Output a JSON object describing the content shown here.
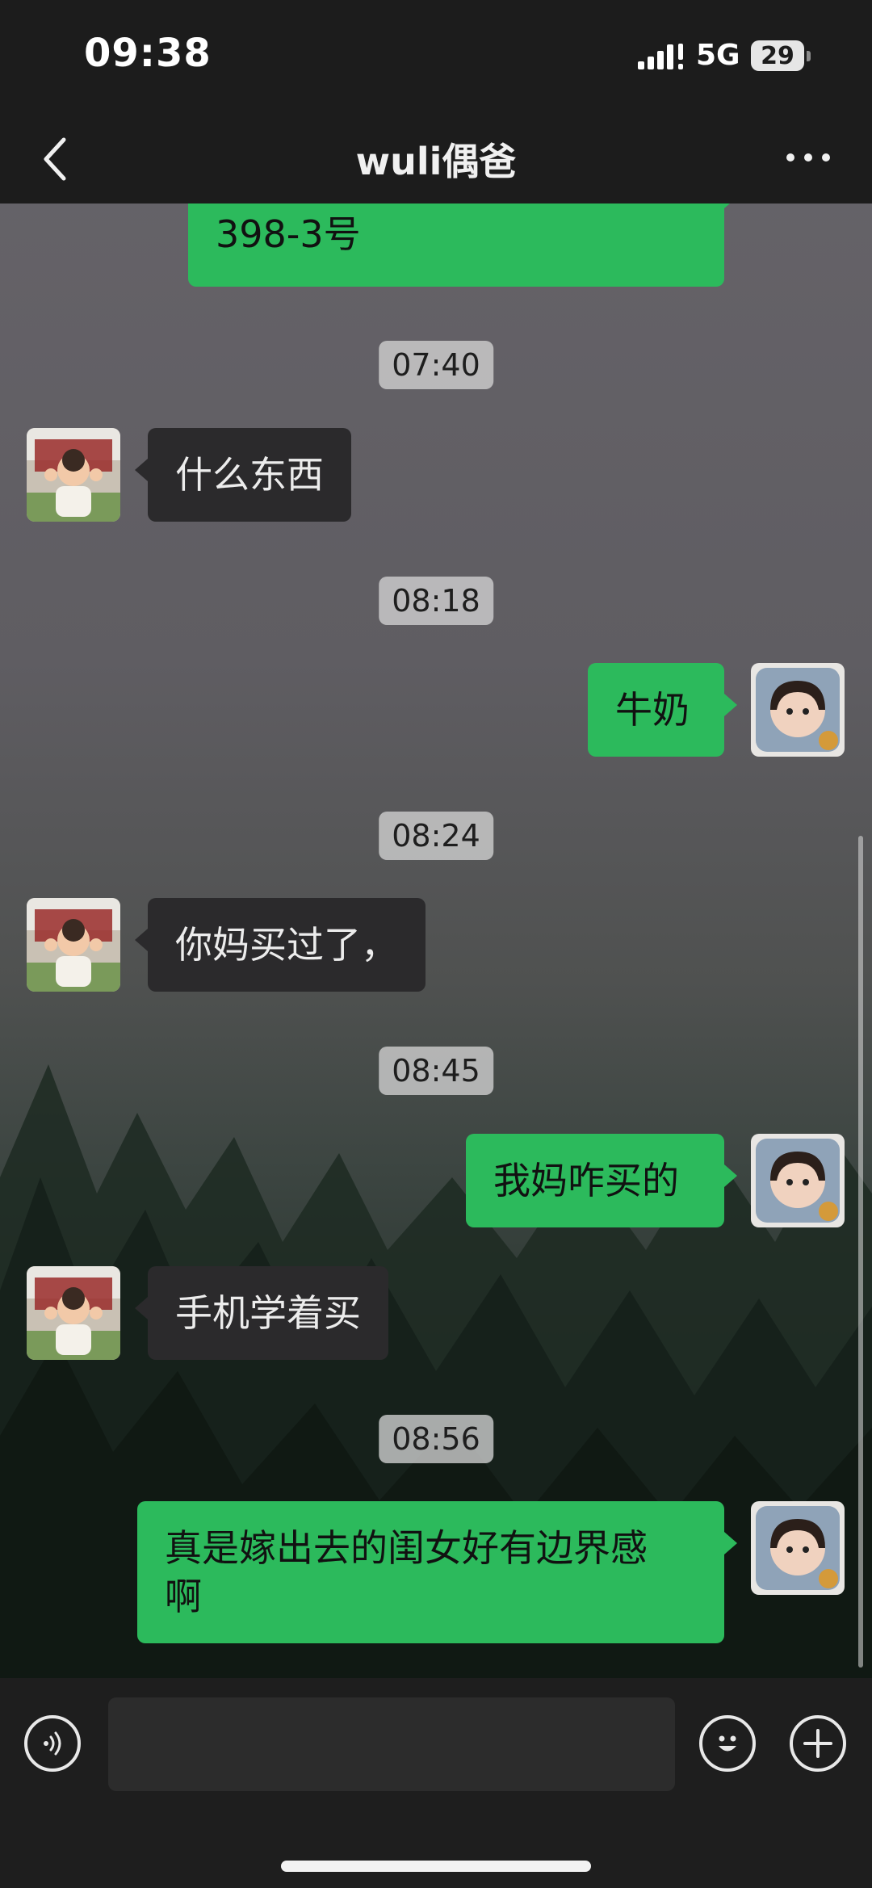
{
  "status_bar": {
    "time": "09:38",
    "network": "5G",
    "battery": "29"
  },
  "header": {
    "title": "wuli偶爸"
  },
  "messages": {
    "m0": {
      "lines": [
        "398-3号"
      ]
    },
    "t1": "07:40",
    "m1": "什么东西",
    "t2": "08:18",
    "m2": "牛奶",
    "t3": "08:24",
    "m3": "你妈买过了，",
    "t4": "08:45",
    "m4": "我妈咋买的",
    "m5": "手机学着买",
    "t5": "08:56",
    "m6": {
      "lines": [
        "真是嫁出去的闺女好有边界感",
        "啊"
      ]
    }
  },
  "input_bar": {
    "placeholder": ""
  },
  "colors": {
    "outgoing_bubble": "#2cba5c",
    "incoming_bubble": "#2b2a2c",
    "bar": "#1c1c1c"
  },
  "icons": {
    "back": "chevron-left-icon",
    "more": "more-dots-icon",
    "voice": "voice-icon",
    "emoji": "emoji-icon",
    "plus": "plus-icon"
  }
}
